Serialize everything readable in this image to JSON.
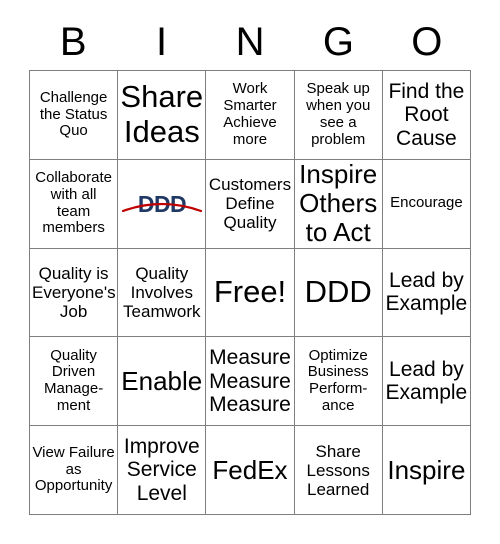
{
  "header": {
    "letters": [
      "B",
      "I",
      "N",
      "G",
      "O"
    ]
  },
  "grid": {
    "rows": [
      [
        {
          "text": "Challenge the Status Quo",
          "size": "sm",
          "kind": "text"
        },
        {
          "text": "Share Ideas",
          "size": "xxl",
          "kind": "text"
        },
        {
          "text": "Work Smarter Achieve more",
          "size": "sm",
          "kind": "text"
        },
        {
          "text": "Speak up when you see a problem",
          "size": "sm",
          "kind": "text"
        },
        {
          "text": "Find the Root Cause",
          "size": "lg",
          "kind": "text"
        }
      ],
      [
        {
          "text": "Collaborate with all team members",
          "size": "sm",
          "kind": "text"
        },
        {
          "text": "DDD",
          "size": "lg",
          "kind": "logo",
          "logo_name": "ddd-logo",
          "logo_text_color": "#1f3864",
          "logo_swoosh_color": "#c00000"
        },
        {
          "text": "Customers Define Quality",
          "size": "md",
          "kind": "text"
        },
        {
          "text": "Inspire Others to Act",
          "size": "xl",
          "kind": "text"
        },
        {
          "text": "Encourage",
          "size": "sm",
          "kind": "text"
        }
      ],
      [
        {
          "text": "Quality is Everyone's Job",
          "size": "md",
          "kind": "text"
        },
        {
          "text": "Quality Involves Teamwork",
          "size": "md",
          "kind": "text"
        },
        {
          "text": "Free!",
          "size": "xxl",
          "kind": "text"
        },
        {
          "text": "DDD",
          "size": "xxl",
          "kind": "text"
        },
        {
          "text": "Lead by Example",
          "size": "lg",
          "kind": "text"
        }
      ],
      [
        {
          "text": "Quality Driven Manage-\nment",
          "size": "sm",
          "kind": "text"
        },
        {
          "text": "Enable",
          "size": "xl",
          "kind": "text"
        },
        {
          "text": "Measure Measure Measure",
          "size": "lg",
          "kind": "text"
        },
        {
          "text": "Optimize Business Perform-\nance",
          "size": "sm",
          "kind": "text"
        },
        {
          "text": "Lead by Example",
          "size": "lg",
          "kind": "text"
        }
      ],
      [
        {
          "text": "View Failure as Opportunity",
          "size": "sm",
          "kind": "text"
        },
        {
          "text": "Improve Service Level",
          "size": "lg",
          "kind": "text"
        },
        {
          "text": "FedEx",
          "size": "xl",
          "kind": "text"
        },
        {
          "text": "Share Lessons Learned",
          "size": "md",
          "kind": "text"
        },
        {
          "text": "Inspire",
          "size": "xl",
          "kind": "text"
        }
      ]
    ]
  },
  "style": {
    "border_color": "#7f7f7f",
    "background": "#ffffff",
    "text_color": "#000000"
  }
}
